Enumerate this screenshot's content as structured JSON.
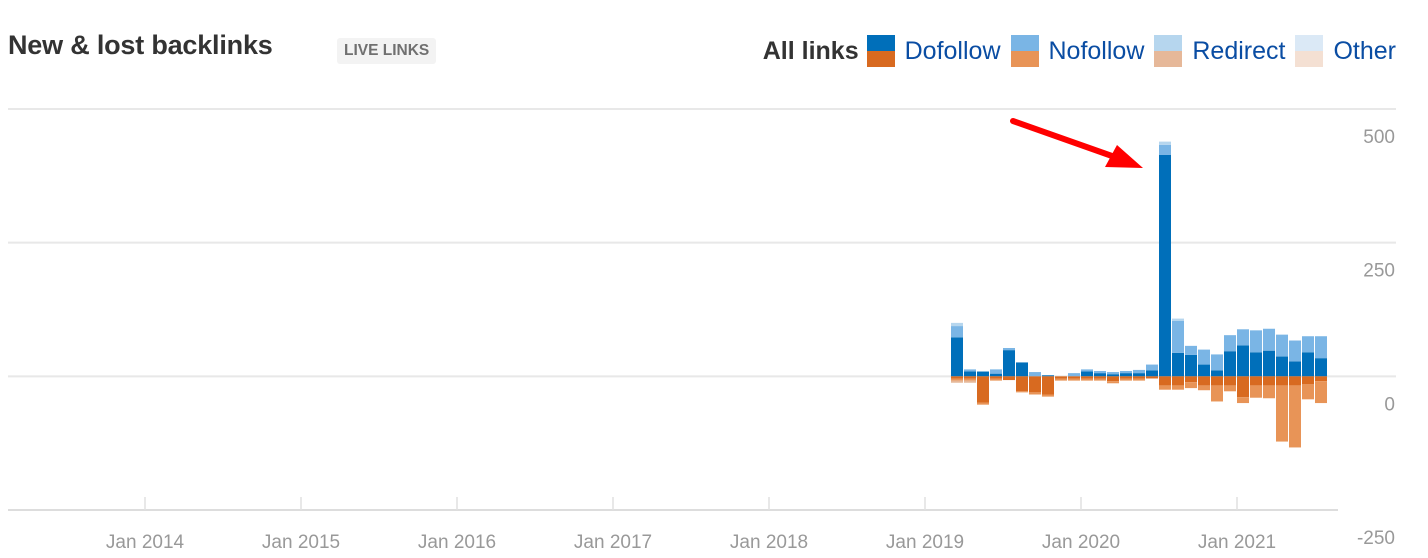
{
  "header": {
    "title": "New & lost backlinks",
    "badge": "LIVE LINKS"
  },
  "legend": {
    "all_label": "All links",
    "items": [
      {
        "label": "Dofollow",
        "pos_color": "#006fba",
        "neg_color": "#d86a20"
      },
      {
        "label": "Nofollow",
        "pos_color": "#7ab5e5",
        "neg_color": "#e89457"
      },
      {
        "label": "Redirect",
        "pos_color": "#b6d6ee",
        "neg_color": "#e6b899"
      },
      {
        "label": "Other",
        "pos_color": "#dbe9f6",
        "neg_color": "#f4e0d3"
      }
    ]
  },
  "annotation": {
    "type": "arrow",
    "color": "#ff0000",
    "points_to": "Jul 2020"
  },
  "chart_data": {
    "type": "bar",
    "stacked": true,
    "title": "New & lost backlinks",
    "xlabel": "",
    "ylabel": "",
    "ylim": [
      -250,
      500
    ],
    "yticks": [
      500,
      250,
      0,
      -250
    ],
    "ytick_labels": [
      "500",
      "250",
      "0",
      "-250"
    ],
    "xtick_labels": [
      "Jan 2014",
      "Jan 2015",
      "Jan 2016",
      "Jan 2017",
      "Jan 2018",
      "Jan 2019",
      "Jan 2020",
      "Jan 2021"
    ],
    "xrange": [
      "Jan 2013",
      "Aug 2021"
    ],
    "grid": true,
    "legend_position": "top-right",
    "categories": [
      "Mar 2019",
      "Apr 2019",
      "May 2019",
      "Jun 2019",
      "Jul 2019",
      "Aug 2019",
      "Sep 2019",
      "Oct 2019",
      "Nov 2019",
      "Dec 2019",
      "Jan 2020",
      "Feb 2020",
      "Mar 2020",
      "Apr 2020",
      "May 2020",
      "Jun 2020",
      "Jul 2020",
      "Aug 2020",
      "Sep 2020",
      "Oct 2020",
      "Nov 2020",
      "Dec 2020",
      "Jan 2021",
      "Feb 2021",
      "Mar 2021",
      "Apr 2021",
      "May 2021",
      "Jun 2021",
      "Jul 2021"
    ],
    "series": [
      {
        "name": "Dofollow (new)",
        "values": [
          73,
          9,
          9,
          5,
          49,
          26,
          0,
          2,
          0,
          0,
          9,
          6,
          4,
          6,
          6,
          11,
          414,
          44,
          40,
          22,
          11,
          47,
          58,
          45,
          48,
          37,
          28,
          45,
          34
        ]
      },
      {
        "name": "Nofollow (new)",
        "values": [
          21,
          4,
          0,
          8,
          4,
          0,
          8,
          0,
          0,
          6,
          4,
          4,
          4,
          4,
          6,
          11,
          19,
          60,
          17,
          28,
          30,
          30,
          30,
          41,
          41,
          41,
          39,
          30,
          41
        ]
      },
      {
        "name": "Redirect (new)",
        "values": [
          6,
          0,
          0,
          0,
          0,
          0,
          0,
          0,
          0,
          0,
          0,
          0,
          0,
          0,
          0,
          0,
          6,
          4,
          0,
          0,
          0,
          0,
          0,
          0,
          0,
          0,
          0,
          0,
          0
        ]
      },
      {
        "name": "Dofollow (lost)",
        "values": [
          -4,
          -4,
          -49,
          -4,
          -7,
          -28,
          -30,
          -34,
          -4,
          -4,
          -4,
          -4,
          -9,
          -4,
          -4,
          -4,
          -17,
          -17,
          -11,
          -17,
          -17,
          -17,
          -39,
          -17,
          -17,
          -17,
          -17,
          -15,
          -9
        ]
      },
      {
        "name": "Nofollow (lost)",
        "values": [
          -4,
          -4,
          -4,
          -4,
          0,
          -2,
          -4,
          -4,
          -4,
          -4,
          -4,
          -4,
          -4,
          -4,
          -4,
          0,
          -8,
          -8,
          -11,
          -9,
          -30,
          -11,
          -11,
          -23,
          -24,
          -105,
          -116,
          -28,
          -41
        ]
      },
      {
        "name": "Redirect (lost)",
        "values": [
          -4,
          -4,
          0,
          0,
          0,
          0,
          0,
          0,
          0,
          0,
          0,
          0,
          0,
          0,
          0,
          0,
          0,
          0,
          0,
          0,
          0,
          0,
          0,
          0,
          0,
          0,
          0,
          0,
          0
        ]
      }
    ]
  }
}
